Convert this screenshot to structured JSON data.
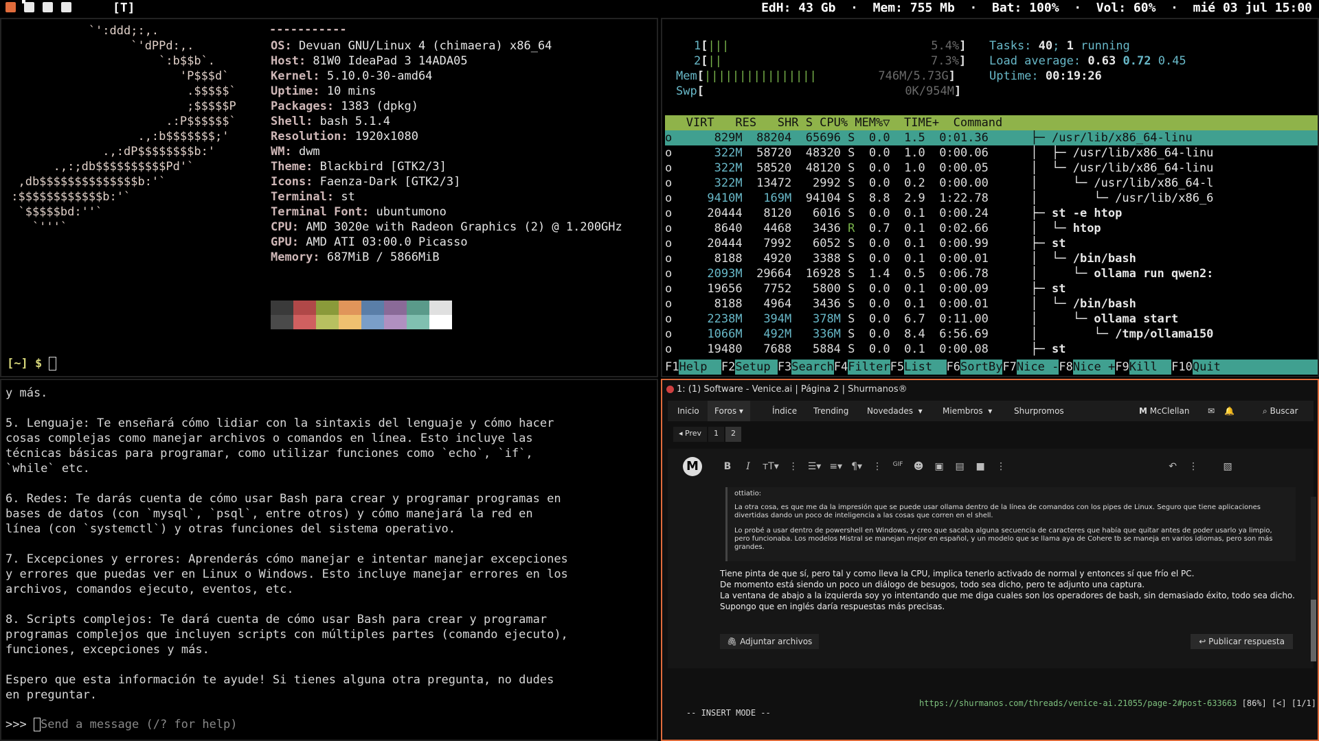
{
  "topbar": {
    "layout": "[T]",
    "status": "EdH: 43 Gb  ·  Mem: 755 Mb  ·  Bat: 100%  ·  Vol: 60%  ·  mié 03 jul 15:00"
  },
  "neofetch": {
    "art": [
      "            `':ddd;:,.",
      "                  `'dPPd:,.",
      "                      `:b$$b`.",
      "                         'P$$$d`",
      "                          .$$$$$`",
      "                          ;$$$$$P",
      "                       .:P$$$$$$`",
      "                   .,:b$$$$$$$;'",
      "              .,:dP$$$$$$$$b:'",
      "       .,:;db$$$$$$$$$$Pd'`",
      "  ,db$$$$$$$$$$$$$$b:'`",
      " :$$$$$$$$$$$$b:'`",
      "  `$$$$$bd:''`",
      "    `'''`"
    ],
    "rows": [
      {
        "label": "OS:",
        "value": "Devuan GNU/Linux 4 (chimaera) x86_64"
      },
      {
        "label": "Host:",
        "value": "81W0 IdeaPad 3 14ADA05"
      },
      {
        "label": "Kernel:",
        "value": "5.10.0-30-amd64"
      },
      {
        "label": "Uptime:",
        "value": "10 mins"
      },
      {
        "label": "Packages:",
        "value": "1383 (dpkg)"
      },
      {
        "label": "Shell:",
        "value": "bash 5.1.4"
      },
      {
        "label": "Resolution:",
        "value": "1920x1080"
      },
      {
        "label": "WM:",
        "value": "dwm"
      },
      {
        "label": "Theme:",
        "value": "Blackbird [GTK2/3]"
      },
      {
        "label": "Icons:",
        "value": "Faenza-Dark [GTK2/3]"
      },
      {
        "label": "Terminal:",
        "value": "st"
      },
      {
        "label": "Terminal Font:",
        "value": "ubuntumono"
      },
      {
        "label": "CPU:",
        "value": "AMD 3020e with Radeon Graphics (2) @ 1.200GHz"
      },
      {
        "label": "GPU:",
        "value": "AMD ATI 03:00.0 Picasso"
      },
      {
        "label": "Memory:",
        "value": "687MiB / 5866MiB"
      }
    ],
    "separator": "-----------",
    "palette": [
      "#3a3a3a",
      "#b04848",
      "#8a9a3a",
      "#e0955a",
      "#5a7ea8",
      "#8a6a98",
      "#5a9a8a",
      "#e0e0e0",
      "#4a4a4a",
      "#d06060",
      "#b8c060",
      "#f0c070",
      "#7a9ec8",
      "#b090c0",
      "#80c0b0",
      "#ffffff"
    ],
    "prompt": "[~] $ "
  },
  "htop": {
    "cpu1": {
      "label": "1",
      "bar": "|||",
      "value": "5.4%"
    },
    "cpu2": {
      "label": "2",
      "bar": "||",
      "value": "7.3%"
    },
    "mem": {
      "label": "Mem",
      "bar": "||||||||||||||||",
      "value": "746M/5.73G"
    },
    "swp": {
      "label": "Swp",
      "bar": "",
      "value": "0K/954M"
    },
    "tasks_label": "Tasks:",
    "tasks": "40",
    "running": "1",
    "running_label": "running",
    "load_label": "Load average:",
    "load1": "0.63",
    "load5": "0.72",
    "load15": "0.45",
    "uptime_label": "Uptime:",
    "uptime": "00:19:26",
    "header": "   VIRT   RES   SHR S CPU% MEM%▽  TIME+  Command",
    "processes": [
      {
        "pre": "o",
        "virt": "829M",
        "res": "88204",
        "shr": "65696",
        "s": "S",
        "cpu": "0.0",
        "mem": "1.5",
        "time": "0:01.36",
        "cmd": "├─ /usr/lib/x86_64-linu"
      },
      {
        "pre": "o",
        "virt": "322M",
        "res": "58720",
        "shr": "48320",
        "s": "S",
        "cpu": "0.0",
        "mem": "1.0",
        "time": "0:00.06",
        "cmd": "│  ├─ /usr/lib/x86_64-linu"
      },
      {
        "pre": "o",
        "virt": "322M",
        "res": "58520",
        "shr": "48120",
        "s": "S",
        "cpu": "0.0",
        "mem": "1.0",
        "time": "0:00.05",
        "cmd": "│  └─ /usr/lib/x86_64-linu"
      },
      {
        "pre": "o",
        "virt": "322M",
        "res": "13472",
        "shr": "2992",
        "s": "S",
        "cpu": "0.0",
        "mem": "0.2",
        "time": "0:00.00",
        "cmd": "│     └─ /usr/lib/x86_64-l"
      },
      {
        "pre": "o",
        "virt": "9410M",
        "res": "169M",
        "shr": "94104",
        "s": "S",
        "cpu": "8.8",
        "mem": "2.9",
        "time": "1:22.78",
        "cmd": "│        └─ /usr/lib/x86_6"
      },
      {
        "pre": "o",
        "virt": "20444",
        "res": "8120",
        "shr": "6016",
        "s": "S",
        "cpu": "0.0",
        "mem": "0.1",
        "time": "0:00.24",
        "cmd": "├─ st -e htop"
      },
      {
        "pre": "o",
        "virt": "8640",
        "res": "4468",
        "shr": "3436",
        "s": "R",
        "cpu": "0.7",
        "mem": "0.1",
        "time": "0:02.66",
        "cmd": "│  └─ htop"
      },
      {
        "pre": "o",
        "virt": "20444",
        "res": "7992",
        "shr": "6052",
        "s": "S",
        "cpu": "0.0",
        "mem": "0.1",
        "time": "0:00.99",
        "cmd": "├─ st"
      },
      {
        "pre": "o",
        "virt": "8188",
        "res": "4920",
        "shr": "3388",
        "s": "S",
        "cpu": "0.0",
        "mem": "0.1",
        "time": "0:00.01",
        "cmd": "│  └─ /bin/bash"
      },
      {
        "pre": "o",
        "virt": "2093M",
        "res": "29664",
        "shr": "16928",
        "s": "S",
        "cpu": "1.4",
        "mem": "0.5",
        "time": "0:06.78",
        "cmd": "│     └─ ollama run qwen2:"
      },
      {
        "pre": "o",
        "virt": "19656",
        "res": "7752",
        "shr": "5800",
        "s": "S",
        "cpu": "0.0",
        "mem": "0.1",
        "time": "0:00.09",
        "cmd": "├─ st"
      },
      {
        "pre": "o",
        "virt": "8188",
        "res": "4964",
        "shr": "3436",
        "s": "S",
        "cpu": "0.0",
        "mem": "0.1",
        "time": "0:00.01",
        "cmd": "│  └─ /bin/bash"
      },
      {
        "pre": "o",
        "virt": "2238M",
        "res": "394M",
        "shr": "378M",
        "s": "S",
        "cpu": "0.0",
        "mem": "6.7",
        "time": "0:11.00",
        "cmd": "│     └─ ollama start"
      },
      {
        "pre": "o",
        "virt": "1066M",
        "res": "492M",
        "shr": "336M",
        "s": "S",
        "cpu": "0.0",
        "mem": "8.4",
        "time": "6:56.69",
        "cmd": "│        └─ /tmp/ollama150"
      },
      {
        "pre": "o",
        "virt": "19480",
        "res": "7688",
        "shr": "5884",
        "s": "S",
        "cpu": "0.0",
        "mem": "0.1",
        "time": "0:00.08",
        "cmd": "├─ st"
      }
    ],
    "fkeys": [
      {
        "k": "F1",
        "l": "Help  "
      },
      {
        "k": "F2",
        "l": "Setup "
      },
      {
        "k": "F3",
        "l": "Search"
      },
      {
        "k": "F4",
        "l": "Filter"
      },
      {
        "k": "F5",
        "l": "List  "
      },
      {
        "k": "F6",
        "l": "SortBy"
      },
      {
        "k": "F7",
        "l": "Nice -"
      },
      {
        "k": "F8",
        "l": "Nice +"
      },
      {
        "k": "F9",
        "l": "Kill  "
      },
      {
        "k": "F10",
        "l": "Quit  "
      }
    ]
  },
  "chat": {
    "text": "y más.\n\n5. Lenguaje: Te enseñará cómo lidiar con la sintaxis del lenguaje y cómo hacer\ncosas complejas como manejar archivos o comandos en línea. Esto incluye las\ntécnicas básicas para programar, como utilizar funciones como `echo`, `if`,\n`while` etc.\n\n6. Redes: Te darás cuenta de cómo usar Bash para crear y programar programas en\nbases de datos (con `mysql`, `psql`, entre otros) y cómo manejará la red en\nlínea (con `systemctl`) y otras funciones del sistema operativo.\n\n7. Excepciones y errores: Aprenderás cómo manejar e intentar manejar excepciones\ny errores que puedas ver en Linux o Windows. Esto incluye manejar errores en los\narchivos, comandos ejecuto, eventos, etc.\n\n8. Scripts complejos: Te dará cuenta de cómo usar Bash para crear y programar\nprogramas complejos que incluyen scripts con múltiples partes (comando ejecuto),\nfunciones, excepciones y más.\n\nEspero que esta información te ayude! Si tienes alguna otra pregunta, no dudes\nen preguntar.",
    "prompt": ">>> ",
    "placeholder": "Send a message (/? for help)"
  },
  "browser": {
    "title": "1: (1) Software - Venice.ai | Página 2 | Shurmanos®",
    "nav": {
      "inicio": "Inicio",
      "foros": "Foros",
      "indice": "Índice",
      "trending": "Trending",
      "novedades": "Novedades",
      "miembros": "Miembros",
      "shurpromos": "Shurpromos",
      "user": "McClellan",
      "buscar": "Buscar"
    },
    "pager": {
      "prev": "◂ Prev",
      "p1": "1",
      "p2": "2"
    },
    "avatar": "M",
    "quote_author": "ottiatio:",
    "quote_p1": "La otra cosa, es que me da la impresión que se puede usar ollama dentro de la línea de comandos con los pipes de Linux. Seguro que tiene aplicaciones divertidas dando un poco de inteligencia a las cosas que corren en el shell.",
    "quote_p2": "Lo probé a usar dentro de powershell en Windows, y creo que sacaba alguna secuencia de caracteres que había que quitar antes de poder usarlo ya limpio, pero funcionaba. Los modelos Mistral se manejan mejor en español, y un modelo que se llama aya de Cohere tb se maneja en varios idiomas, pero son más grandes.",
    "reply": "Tiene pinta de que sí, pero tal y como lleva la CPU, implica tenerlo activado de normal y entonces sí que frío el PC.\nDe momento está siendo un poco un diálogo de besugos, todo sea dicho, pero te adjunto una captura.\nLa ventana de abajo a la izquierda soy yo intentando que me diga cuales son los operadores de bash, sin demasiado éxito, todo sea dicho.\nSupongo que en inglés daría respuestas más precisas.",
    "attach": "Adjuntar archivos",
    "publish": "Publicar respuesta",
    "mode": "-- INSERT MODE --",
    "url": "https://shurmanos.com/threads/venice-ai.21055/page-2#post-633663",
    "url_meta": " [86%] [<] [1/1]"
  }
}
